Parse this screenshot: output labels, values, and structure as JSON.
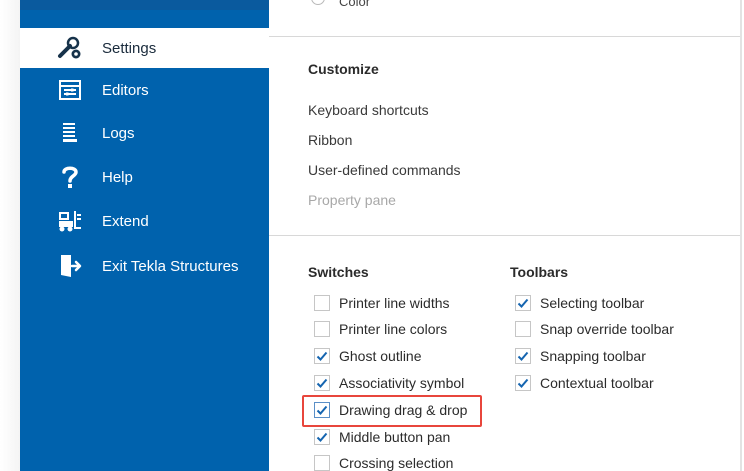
{
  "sidebar": {
    "items": [
      {
        "label": "Settings",
        "icon": "wrench-gear-icon",
        "active": true
      },
      {
        "label": "Editors",
        "icon": "editors-icon",
        "active": false
      },
      {
        "label": "Logs",
        "icon": "logs-icon",
        "active": false
      },
      {
        "label": "Help",
        "icon": "question-icon",
        "active": false
      },
      {
        "label": "Extend",
        "icon": "extend-icon",
        "active": false
      },
      {
        "label": "Exit Tekla Structures",
        "icon": "exit-icon",
        "active": false
      }
    ]
  },
  "content": {
    "cut_option": "Color",
    "customize": {
      "title": "Customize",
      "links": [
        {
          "label": "Keyboard shortcuts",
          "enabled": true
        },
        {
          "label": "Ribbon",
          "enabled": true
        },
        {
          "label": "User-defined commands",
          "enabled": true
        },
        {
          "label": "Property pane",
          "enabled": false
        }
      ]
    },
    "switches": {
      "title": "Switches",
      "items": [
        {
          "label": "Printer line widths",
          "checked": false
        },
        {
          "label": "Printer line colors",
          "checked": false
        },
        {
          "label": "Ghost outline",
          "checked": true
        },
        {
          "label": "Associativity symbol",
          "checked": true
        },
        {
          "label": "Drawing drag & drop",
          "checked": true,
          "highlighted": true
        },
        {
          "label": "Middle button pan",
          "checked": true
        },
        {
          "label": "Crossing selection",
          "checked": false
        }
      ]
    },
    "toolbars": {
      "title": "Toolbars",
      "items": [
        {
          "label": "Selecting toolbar",
          "checked": true
        },
        {
          "label": "Snap override toolbar",
          "checked": false
        },
        {
          "label": "Snapping toolbar",
          "checked": true
        },
        {
          "label": "Contextual toolbar",
          "checked": true
        }
      ]
    }
  },
  "colors": {
    "sidebar_bg": "#0062ad",
    "checkmark": "#1565b0",
    "highlight_border": "#e8463c"
  }
}
